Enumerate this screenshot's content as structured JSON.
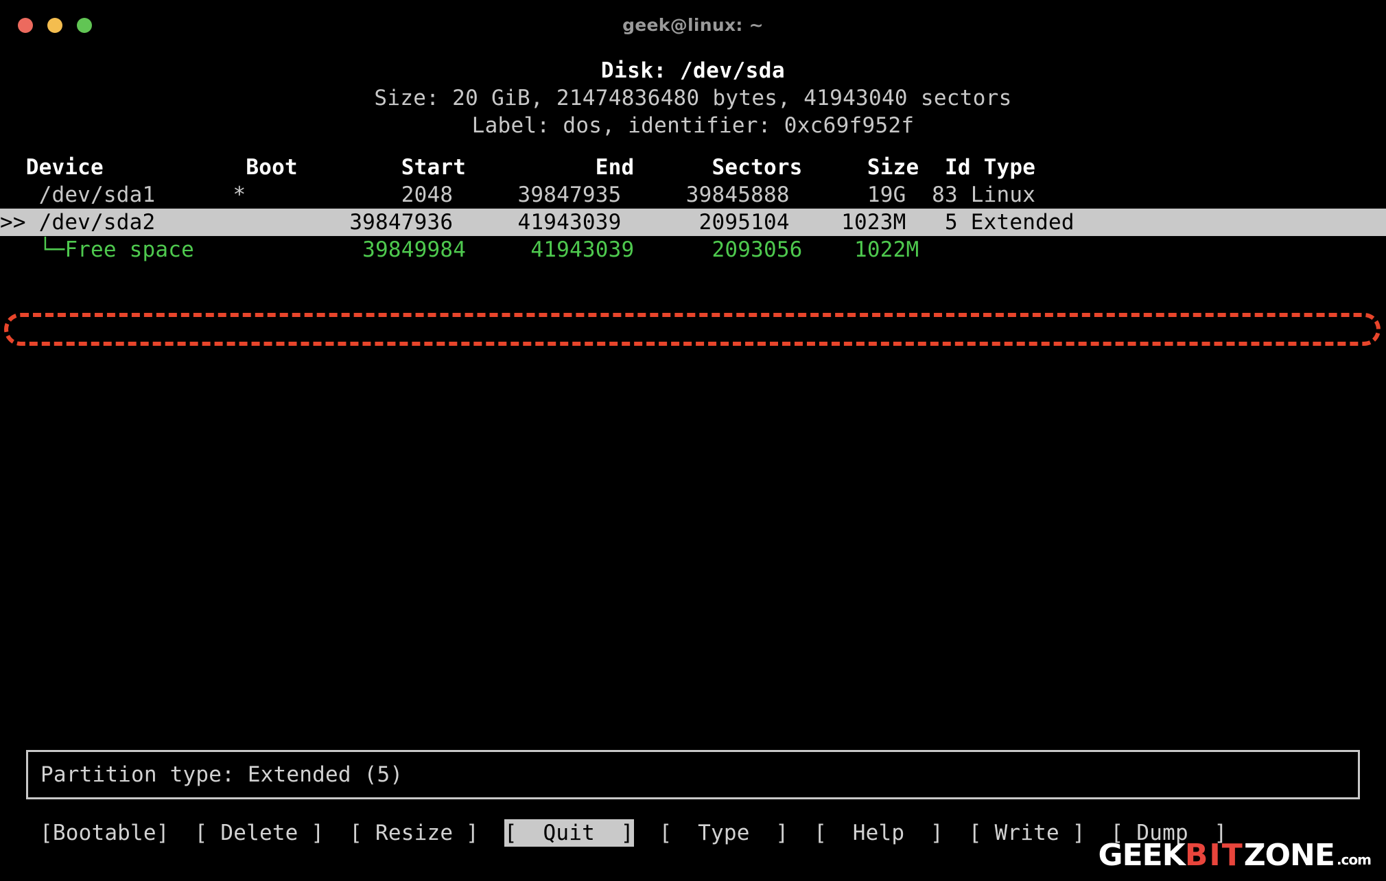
{
  "window": {
    "title": "geek@linux: ~",
    "controls": [
      "close",
      "minimize",
      "maximize"
    ],
    "colors": {
      "close": "#ec6a5e",
      "minimize": "#f4bd4f",
      "maximize": "#61c554",
      "background": "#000000",
      "foreground": "#c8c8c8",
      "freespace": "#4ec94e",
      "annotation": "#e8452b",
      "selection_bg": "#c9c9c9"
    }
  },
  "disk": {
    "title": "Disk: /dev/sda",
    "size_line": "Size: 20 GiB, 21474836480 bytes, 41943040 sectors",
    "label_line": "Label: dos, identifier: 0xc69f952f"
  },
  "table": {
    "header": "  Device           Boot        Start          End      Sectors     Size  Id Type",
    "columns": [
      "Device",
      "Boot",
      "Start",
      "End",
      "Sectors",
      "Size",
      "Id",
      "Type"
    ],
    "rows": [
      {
        "line": "   /dev/sda1      *            2048     39847935     39845888      19G  83 Linux",
        "device": "/dev/sda1",
        "boot": "*",
        "start": "2048",
        "end": "39847935",
        "sectors": "39845888",
        "size": "19G",
        "id": "83",
        "type": "Linux",
        "state": "normal"
      },
      {
        "line": ">> /dev/sda2               39847936     41943039      2095104    1023M   5 Extended",
        "marker": ">>",
        "device": "/dev/sda2",
        "boot": "",
        "start": "39847936",
        "end": "41943039",
        "sectors": "2095104",
        "size": "1023M",
        "id": "5",
        "type": "Extended",
        "state": "selected"
      },
      {
        "line": "   └─Free space             39849984     41943039      2093056    1022M",
        "device": "└─Free space",
        "boot": "",
        "start": "39849984",
        "end": "41943039",
        "sectors": "2093056",
        "size": "1022M",
        "id": "",
        "type": "",
        "state": "freespace"
      }
    ]
  },
  "status": {
    "text": "Partition type: Extended (5)"
  },
  "menu": {
    "items": [
      {
        "label": "[Bootable]",
        "active": false
      },
      {
        "label": "[ Delete ]",
        "active": false
      },
      {
        "label": "[ Resize ]",
        "active": false
      },
      {
        "label": "[  Quit  ]",
        "active": true
      },
      {
        "label": "[  Type  ]",
        "active": false
      },
      {
        "label": "[  Help  ]",
        "active": false
      },
      {
        "label": "[ Write ]",
        "active": false
      },
      {
        "label": "[ Dump  ]",
        "active": false
      }
    ]
  },
  "watermark": {
    "part1": "GEEK",
    "part2": "BIT",
    "part3": "ZONE",
    "suffix": ".com"
  }
}
